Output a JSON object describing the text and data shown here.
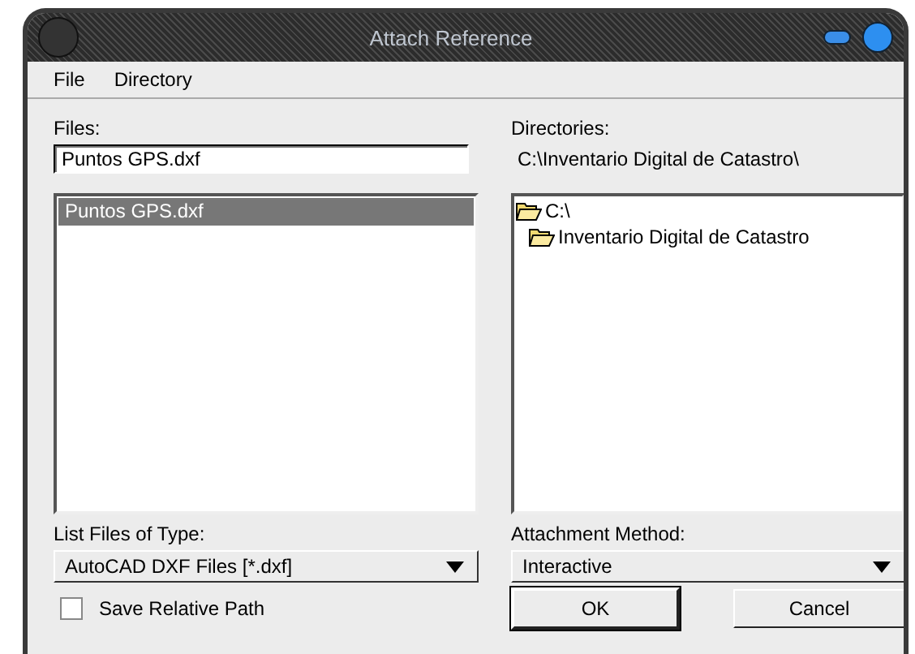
{
  "window": {
    "title": "Attach Reference"
  },
  "menu": [
    {
      "label": "File"
    },
    {
      "label": "Directory"
    }
  ],
  "files": {
    "label": "Files:",
    "value": "Puntos GPS.dxf",
    "items": [
      {
        "name": "Puntos GPS.dxf",
        "selected": true
      }
    ]
  },
  "directories": {
    "label": "Directories:",
    "path": "C:\\Inventario Digital de Catastro\\",
    "tree": [
      {
        "name": "C:\\",
        "children": [
          {
            "name": "Inventario Digital de Catastro"
          }
        ]
      }
    ]
  },
  "file_type": {
    "label": "List Files of Type:",
    "value": "AutoCAD DXF Files [*.dxf]"
  },
  "attachment_method": {
    "label": "Attachment Method:",
    "value": "Interactive"
  },
  "save_relative_path": {
    "label": "Save Relative Path",
    "checked": false
  },
  "buttons": [
    {
      "label": "OK",
      "default": true
    },
    {
      "label": "Cancel",
      "default": false
    }
  ]
}
